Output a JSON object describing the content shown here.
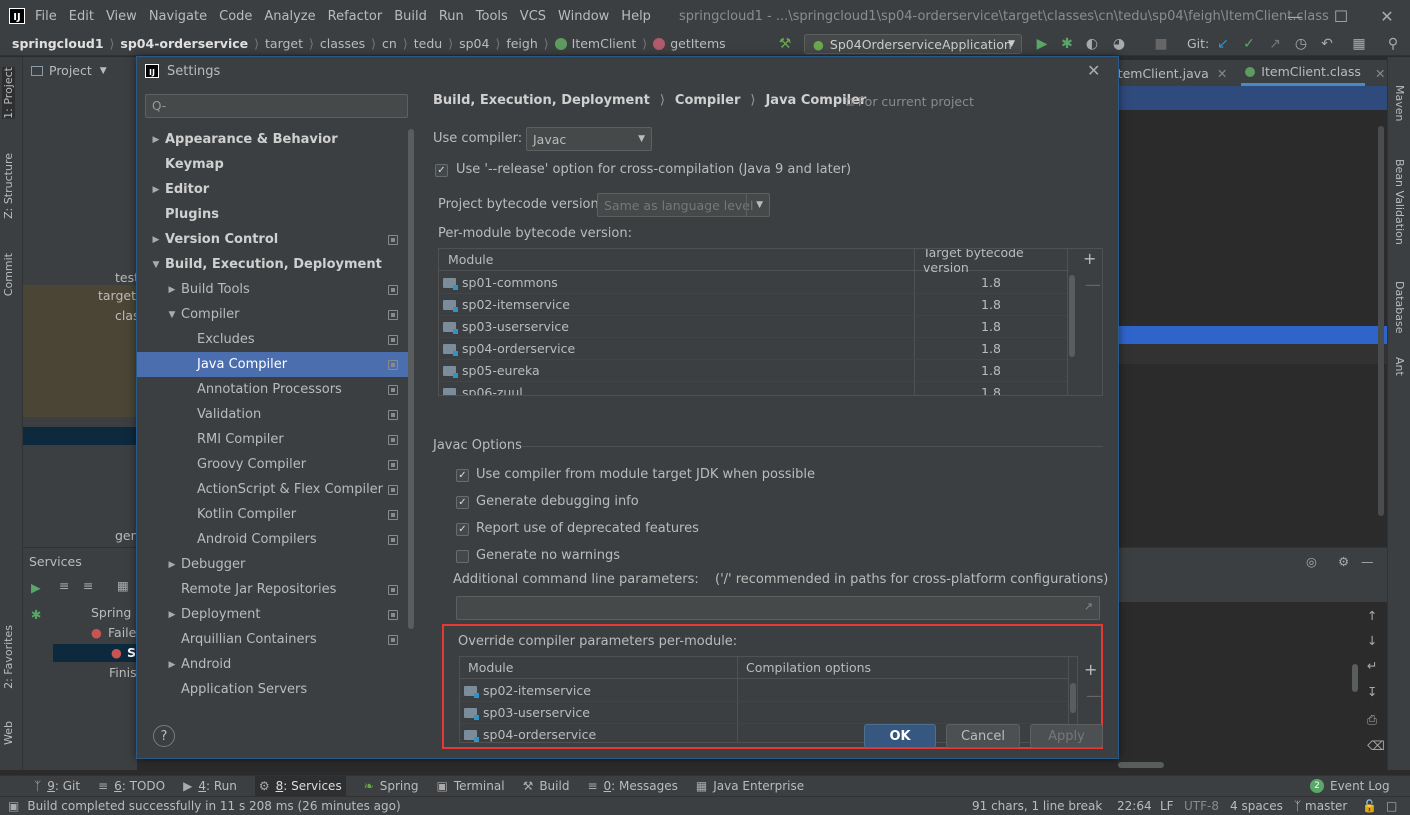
{
  "app": {
    "logo_text": "IJ",
    "menu": [
      "File",
      "Edit",
      "View",
      "Navigate",
      "Code",
      "Analyze",
      "Refactor",
      "Build",
      "Run",
      "Tools",
      "VCS",
      "Window",
      "Help"
    ],
    "window_title": "springcloud1 - ...\\springcloud1\\sp04-orderservice\\target\\classes\\cn\\tedu\\sp04\\feigh\\ItemClient.class"
  },
  "navbar": {
    "crumbs": [
      "springcloud1",
      "sp04-orderservice",
      "target",
      "classes",
      "cn",
      "tedu",
      "sp04",
      "feigh",
      "ItemClient",
      "getItems"
    ],
    "run_config": "Sp04OrderserviceApplication",
    "git_label": "Git:"
  },
  "left_strip": [
    "1: Project",
    "Z: Structure",
    "Commit",
    "2: Favorites",
    "Web"
  ],
  "right_strip": [
    "Maven",
    "Bean Validation",
    "Database",
    "Ant"
  ],
  "project_panel": {
    "title": "Project",
    "items": [
      "test",
      "target",
      "clas",
      "gen"
    ]
  },
  "editor_tabs": [
    "ItemClient.java",
    "ItemClient.class"
  ],
  "services": {
    "title": "Services",
    "items": [
      "Spring",
      "Faile",
      "S",
      "Finis"
    ]
  },
  "bottom_tabs": [
    {
      "key": "9",
      "label": "Git"
    },
    {
      "key": "6",
      "label": "TODO"
    },
    {
      "key": "4",
      "label": "Run"
    },
    {
      "key": "8",
      "label": "Services"
    },
    {
      "key": "",
      "label": "Spring"
    },
    {
      "key": "",
      "label": "Terminal"
    },
    {
      "key": "",
      "label": "Build"
    },
    {
      "key": "0",
      "label": "Messages"
    },
    {
      "key": "",
      "label": "Java Enterprise"
    }
  ],
  "event_log": {
    "badge": "2",
    "label": "Event Log"
  },
  "status": {
    "message": "Build completed successfully in 11 s 208 ms (26 minutes ago)",
    "chars": "91 chars, 1 line break",
    "position": "22:64",
    "line_sep": "LF",
    "encoding": "UTF-8",
    "indent": "4 spaces",
    "branch": "master"
  },
  "dialog": {
    "title": "Settings",
    "search_placeholder": "Q-",
    "tree": [
      {
        "label": "Appearance & Behavior",
        "level": 0,
        "arrow": "right",
        "bold": true,
        "copy": false
      },
      {
        "label": "Keymap",
        "level": 0,
        "arrow": "",
        "bold": true,
        "copy": false
      },
      {
        "label": "Editor",
        "level": 0,
        "arrow": "right",
        "bold": true,
        "copy": false
      },
      {
        "label": "Plugins",
        "level": 0,
        "arrow": "",
        "bold": true,
        "copy": false
      },
      {
        "label": "Version Control",
        "level": 0,
        "arrow": "right",
        "bold": true,
        "copy": true
      },
      {
        "label": "Build, Execution, Deployment",
        "level": 0,
        "arrow": "down",
        "bold": true,
        "copy": false
      },
      {
        "label": "Build Tools",
        "level": 1,
        "arrow": "right",
        "bold": false,
        "copy": true
      },
      {
        "label": "Compiler",
        "level": 1,
        "arrow": "down",
        "bold": false,
        "copy": true
      },
      {
        "label": "Excludes",
        "level": 2,
        "arrow": "",
        "bold": false,
        "copy": true
      },
      {
        "label": "Java Compiler",
        "level": 2,
        "arrow": "",
        "bold": false,
        "copy": true,
        "selected": true
      },
      {
        "label": "Annotation Processors",
        "level": 2,
        "arrow": "",
        "bold": false,
        "copy": true
      },
      {
        "label": "Validation",
        "level": 2,
        "arrow": "",
        "bold": false,
        "copy": true
      },
      {
        "label": "RMI Compiler",
        "level": 2,
        "arrow": "",
        "bold": false,
        "copy": true
      },
      {
        "label": "Groovy Compiler",
        "level": 2,
        "arrow": "",
        "bold": false,
        "copy": true
      },
      {
        "label": "ActionScript & Flex Compiler",
        "level": 2,
        "arrow": "",
        "bold": false,
        "copy": true
      },
      {
        "label": "Kotlin Compiler",
        "level": 2,
        "arrow": "",
        "bold": false,
        "copy": true
      },
      {
        "label": "Android Compilers",
        "level": 2,
        "arrow": "",
        "bold": false,
        "copy": true
      },
      {
        "label": "Debugger",
        "level": 1,
        "arrow": "right",
        "bold": false,
        "copy": false
      },
      {
        "label": "Remote Jar Repositories",
        "level": 1,
        "arrow": "",
        "bold": false,
        "copy": true
      },
      {
        "label": "Deployment",
        "level": 1,
        "arrow": "right",
        "bold": false,
        "copy": true
      },
      {
        "label": "Arquillian Containers",
        "level": 1,
        "arrow": "",
        "bold": false,
        "copy": true
      },
      {
        "label": "Android",
        "level": 1,
        "arrow": "right",
        "bold": false,
        "copy": false
      },
      {
        "label": "Application Servers",
        "level": 1,
        "arrow": "",
        "bold": false,
        "copy": false
      }
    ],
    "breadcrumb": [
      "Build, Execution, Deployment",
      "Compiler",
      "Java Compiler"
    ],
    "for_current_project": "For current project",
    "use_compiler_label": "Use compiler:",
    "use_compiler_value": "Javac",
    "release_option": {
      "label": "Use '--release' option for cross-compilation (Java 9 and later)",
      "checked": true
    },
    "project_bytecode_label": "Project bytecode version:",
    "project_bytecode_value": "Same as language level",
    "per_module_label": "Per-module bytecode version:",
    "bytecode_table": {
      "columns": [
        "Module",
        "Target bytecode version"
      ],
      "rows": [
        [
          "sp01-commons",
          "1.8"
        ],
        [
          "sp02-itemservice",
          "1.8"
        ],
        [
          "sp03-userservice",
          "1.8"
        ],
        [
          "sp04-orderservice",
          "1.8"
        ],
        [
          "sp05-eureka",
          "1.8"
        ],
        [
          "sp06-zuul",
          "1.8"
        ]
      ]
    },
    "javac_options_title": "Javac Options",
    "javac_options": [
      {
        "label": "Use compiler from module target JDK when possible",
        "checked": true
      },
      {
        "label": "Generate debugging info",
        "checked": true
      },
      {
        "label": "Report use of deprecated features",
        "checked": true
      },
      {
        "label": "Generate no warnings",
        "checked": false
      }
    ],
    "additional_params_label": "Additional command line parameters:",
    "additional_params_hint": "('/' recommended in paths for cross-platform configurations)",
    "additional_params_value": "",
    "override_label": "Override compiler parameters per-module:",
    "override_table": {
      "columns": [
        "Module",
        "Compilation options"
      ],
      "rows": [
        [
          "sp02-itemservice",
          ""
        ],
        [
          "sp03-userservice",
          ""
        ],
        [
          "sp04-orderservice",
          ""
        ]
      ]
    },
    "buttons": {
      "ok": "OK",
      "cancel": "Cancel",
      "apply": "Apply",
      "help": "?"
    }
  },
  "colors": {
    "selection": "#4b6eaf",
    "highlight_box": "#e53935",
    "primary_button": "#365880"
  }
}
